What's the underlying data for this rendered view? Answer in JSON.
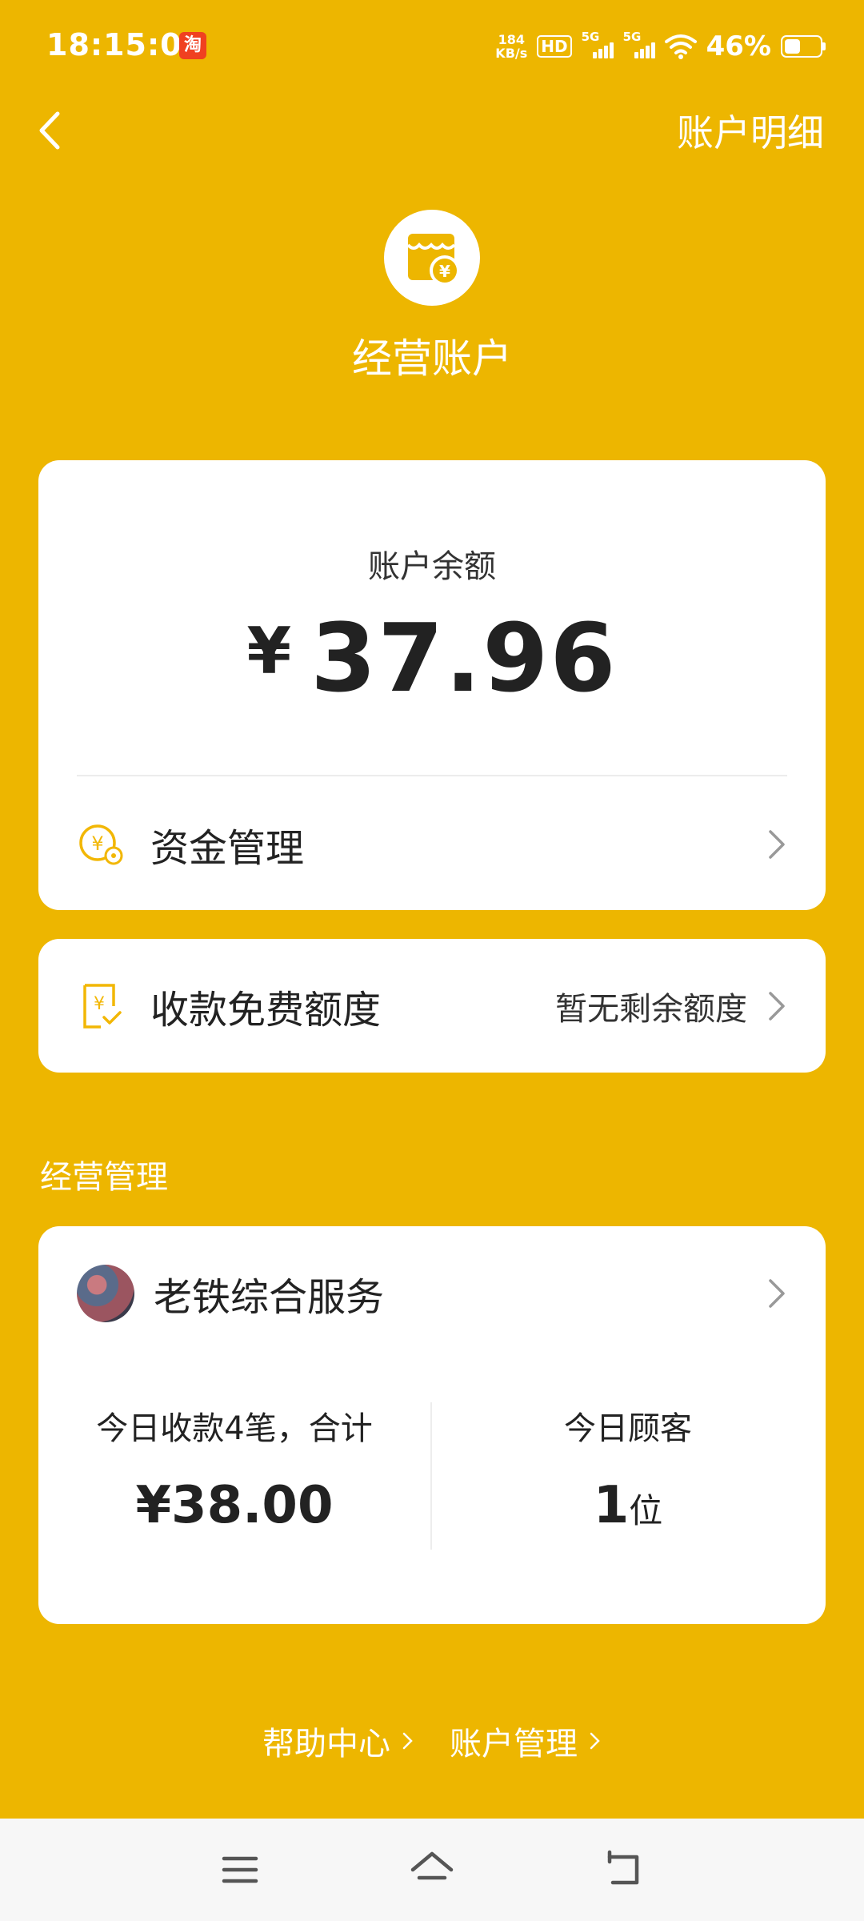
{
  "status_bar": {
    "time": "18:15:08",
    "app_icon": "淘",
    "net_speed_value": "184",
    "net_speed_unit": "KB/s",
    "hd_badge": "HD",
    "signal1_label": "5G",
    "signal2_label": "5G",
    "battery": "46%",
    "battery_level": 0.46
  },
  "header": {
    "right_link": "账户明细",
    "title": "经营账户"
  },
  "balance_card": {
    "label": "账户余额",
    "currency": "¥",
    "amount": "37.96",
    "fund_row_label": "资金管理"
  },
  "quota_card": {
    "label": "收款免费额度",
    "value": "暂无剩余额度"
  },
  "section_title": "经营管理",
  "store_card": {
    "name": "老铁综合服务",
    "stats": [
      {
        "label": "今日收款4笔，合计",
        "value": "¥38.00",
        "unit": ""
      },
      {
        "label": "今日顾客",
        "value": "1",
        "unit": "位"
      }
    ]
  },
  "footer": {
    "links": [
      "帮助中心",
      "账户管理"
    ]
  },
  "colors": {
    "background": "#EDB600",
    "accent": "#F2B705"
  }
}
